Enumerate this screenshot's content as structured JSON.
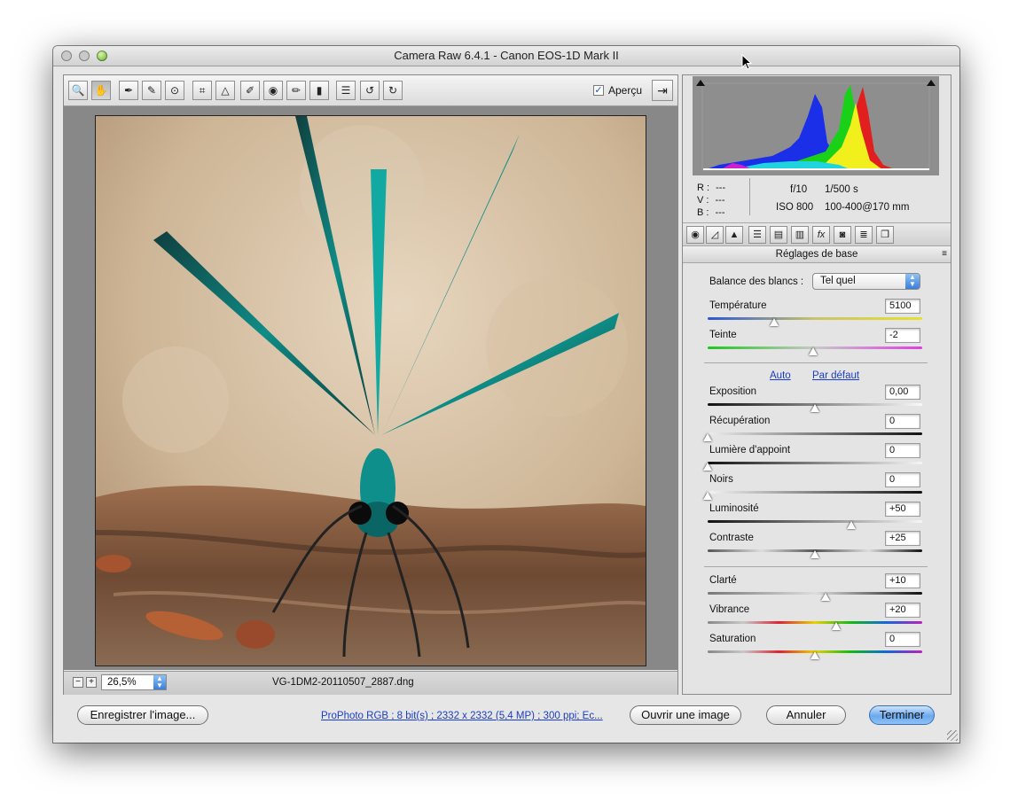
{
  "window": {
    "title": "Camera Raw 6.4.1  -  Canon EOS-1D Mark II"
  },
  "toolbar": {
    "tools": [
      {
        "icon": "zoom-icon",
        "glyph": "🔍"
      },
      {
        "icon": "hand-icon",
        "glyph": "✋"
      },
      {
        "icon": "white-balance-eyedropper-icon",
        "glyph": "✒"
      },
      {
        "icon": "color-sampler-icon",
        "glyph": "✎"
      },
      {
        "icon": "targeted-adjustment-icon",
        "glyph": "⊙"
      },
      {
        "icon": "crop-icon",
        "glyph": "⌗"
      },
      {
        "icon": "straighten-icon",
        "glyph": "△"
      },
      {
        "icon": "spot-removal-icon",
        "glyph": "✐"
      },
      {
        "icon": "red-eye-icon",
        "glyph": "◉"
      },
      {
        "icon": "adjustment-brush-icon",
        "glyph": "✏"
      },
      {
        "icon": "graduated-filter-icon",
        "glyph": "▮"
      },
      {
        "icon": "preferences-icon",
        "glyph": "☰"
      },
      {
        "icon": "rotate-ccw-icon",
        "glyph": "↺"
      },
      {
        "icon": "rotate-cw-icon",
        "glyph": "↻"
      }
    ],
    "preview_label": "Aperçu",
    "preview_checked": true,
    "fullscreen_icon": "fullscreen-icon"
  },
  "status": {
    "zoom_minus": "−",
    "zoom_plus": "+",
    "zoom_value": "26,5%",
    "filename": "VG-1DM2-20110507_2887.dng"
  },
  "info": {
    "r_label": "R :",
    "r_value": "---",
    "v_label": "V :",
    "v_value": "---",
    "b_label": "B :",
    "b_value": "---",
    "aperture": "f/10",
    "shutter": "1/500 s",
    "iso": "ISO 800",
    "lens": "100-400@170 mm"
  },
  "panel_tabs": [
    "basic-icon",
    "tone-curve-icon",
    "detail-icon",
    "hsl-icon",
    "split-toning-icon",
    "lens-corrections-icon",
    "effects-icon",
    "camera-calibration-icon",
    "presets-icon",
    "snapshots-icon"
  ],
  "panel": {
    "header": "Réglages de base",
    "white_balance_label": "Balance des blancs :",
    "white_balance_value": "Tel quel",
    "auto_link": "Auto",
    "default_link": "Par défaut",
    "sliders": [
      {
        "label": "Température",
        "value": "5100",
        "pos": 0.31
      },
      {
        "label": "Teinte",
        "value": "-2",
        "pos": 0.49
      },
      {
        "label": "Exposition",
        "value": "0,00",
        "pos": 0.5
      },
      {
        "label": "Récupération",
        "value": "0",
        "pos": 0.0
      },
      {
        "label": "Lumière d'appoint",
        "value": "0",
        "pos": 0.0
      },
      {
        "label": "Noirs",
        "value": "0",
        "pos": 0.0
      },
      {
        "label": "Luminosité",
        "value": "+50",
        "pos": 0.67
      },
      {
        "label": "Contraste",
        "value": "+25",
        "pos": 0.5
      },
      {
        "label": "Clarté",
        "value": "+10",
        "pos": 0.55
      },
      {
        "label": "Vibrance",
        "value": "+20",
        "pos": 0.6
      },
      {
        "label": "Saturation",
        "value": "0",
        "pos": 0.5
      }
    ]
  },
  "footer": {
    "save_button": "Enregistrer l'image...",
    "workflow_link": "ProPhoto RGB ; 8 bit(s) ; 2332 x 2332 (5,4 MP) ; 300 ppi; Ec...",
    "open_button": "Ouvrir une image",
    "cancel_button": "Annuler",
    "done_button": "Terminer"
  },
  "colors": {
    "accent": "#3b7fd9",
    "link": "#1a3ec2"
  }
}
